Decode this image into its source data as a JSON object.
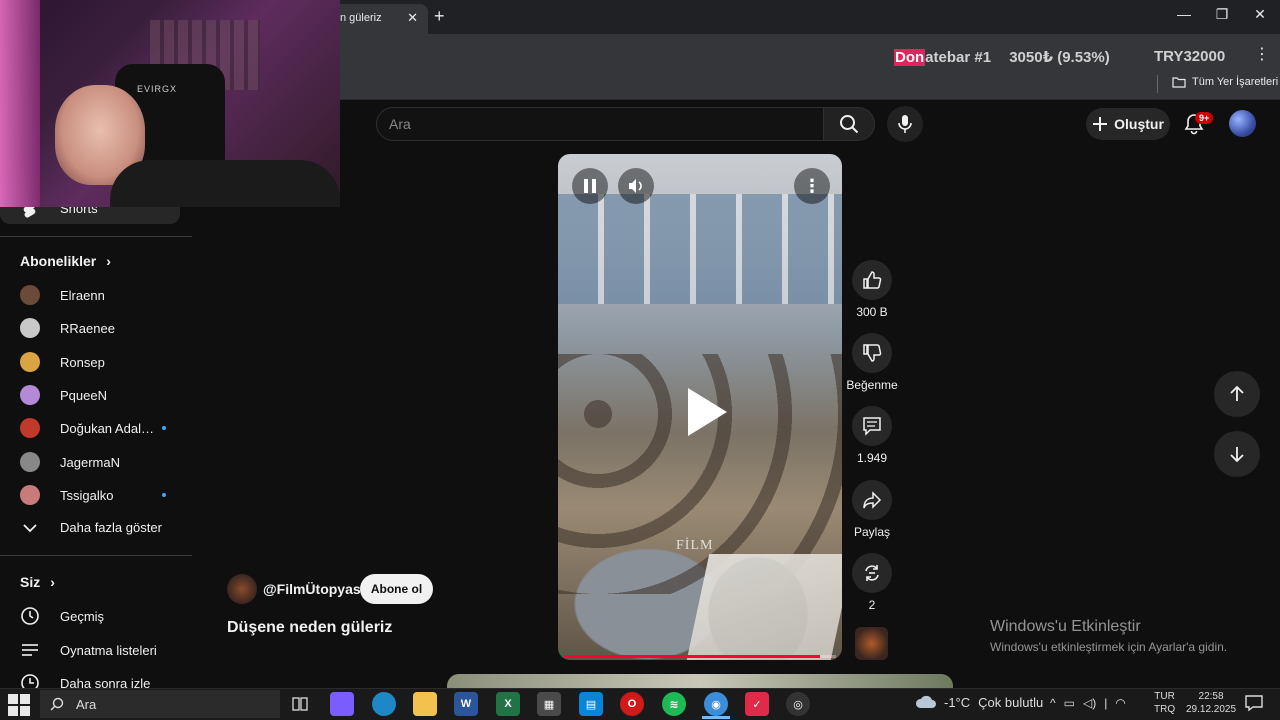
{
  "browser": {
    "tab_title": "n güleriz",
    "new_tab_symbol": "+",
    "tab_close_symbol": "✕",
    "window_controls": [
      "—",
      "❐",
      "✕"
    ],
    "donate_prefix": "Don",
    "donate_rest": "atebar #1",
    "donate_amount": "3050₺ (9.53%)",
    "donate_goal": "TRY32000",
    "all_bookmarks": "Tüm Yer İşaretleri"
  },
  "youtube": {
    "search_placeholder": "Ara",
    "create_label": "Oluştur",
    "notifications_badge": "9+"
  },
  "webcam": {
    "chair_brand": "EVIRGX"
  },
  "sidebar": {
    "shorts_label": "Shorts",
    "subscriptions_heading": "Abonelikler",
    "subscriptions": [
      {
        "name": "Elraenn",
        "color": "#6b4a3a",
        "dot": false
      },
      {
        "name": "RRaenee",
        "color": "#c8c8c8",
        "dot": false
      },
      {
        "name": "Ronsep",
        "color": "#d9a441",
        "dot": false
      },
      {
        "name": "PqueeN",
        "color": "#b48ad6",
        "dot": false
      },
      {
        "name": "Doğukan Adal [T...",
        "color": "#c0392b",
        "dot": true
      },
      {
        "name": "JagermaN",
        "color": "#888888",
        "dot": false
      },
      {
        "name": "Tssigalko",
        "color": "#c97a7a",
        "dot": true
      }
    ],
    "show_more": "Daha fazla göster",
    "you_heading": "Siz",
    "you_items": [
      "Geçmiş",
      "Oynatma listeleri",
      "Daha sonra izle"
    ]
  },
  "short": {
    "channel": "@FilmÜtopyası",
    "subscribe": "Abone ol",
    "title": "Düşene neden güleriz",
    "watermark": "FİLM",
    "progress": 0.94
  },
  "actions": {
    "like_count": "300 B",
    "dislike_label": "Beğenme",
    "comment_count": "1.949",
    "share_label": "Paylaş",
    "remix_count": "2"
  },
  "activation": {
    "title": "Windows'u Etkinleştir",
    "subtitle": "Windows'u etkinleştirmek için Ayarlar'a gidin."
  },
  "taskbar": {
    "search_placeholder": "Ara",
    "temperature": "-1°C",
    "weather": "Çok bulutlu",
    "lang_top": "TUR",
    "lang_bottom": "TRQ",
    "time": "22:58",
    "date": "29.12.2025",
    "apps": [
      {
        "name": "copilot",
        "color": "#7b5cff",
        "label": ""
      },
      {
        "name": "edge",
        "color": "#1e88c7",
        "label": ""
      },
      {
        "name": "explorer",
        "color": "#f2c14e",
        "label": ""
      },
      {
        "name": "word",
        "color": "#2b579a",
        "label": "W"
      },
      {
        "name": "excel",
        "color": "#217346",
        "label": "X"
      },
      {
        "name": "calculator",
        "color": "#4a4a4a",
        "label": "▦"
      },
      {
        "name": "store",
        "color": "#0a84d6",
        "label": "▤"
      },
      {
        "name": "opera",
        "color": "#d01a1a",
        "label": "O"
      },
      {
        "name": "spotify",
        "color": "#1db954",
        "label": "≋"
      },
      {
        "name": "chrome",
        "color": "#3c8dd9",
        "label": "◉"
      },
      {
        "name": "app-red",
        "color": "#e02a4a",
        "label": "✓"
      },
      {
        "name": "obs",
        "color": "#333333",
        "label": "◎"
      }
    ]
  }
}
